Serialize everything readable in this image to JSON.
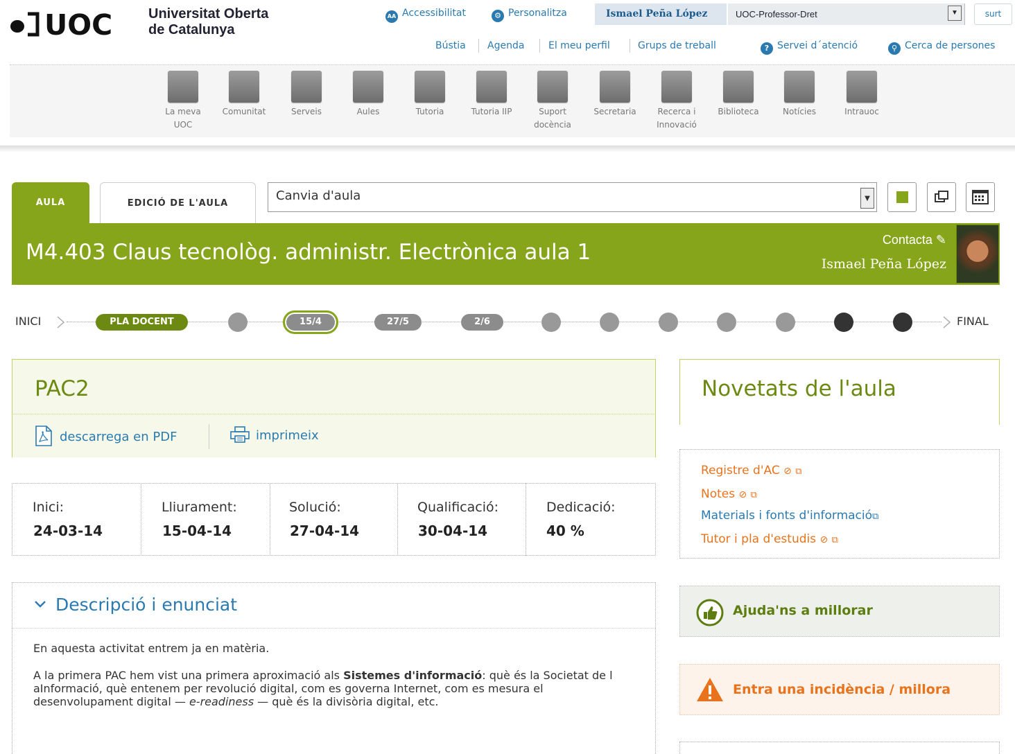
{
  "header": {
    "logo_text": "UOC",
    "university_line1": "Universitat Oberta",
    "university_line2": "de Catalunya",
    "accessibility": "Accessibilitat",
    "personalize": "Personalitza",
    "user_name": "Ismael Peña López",
    "role_value": "UOC-Professor-Dret",
    "exit_label": "surt",
    "sublinks": [
      "Bústia",
      "Agenda",
      "El meu perfil",
      "Grups de treball"
    ],
    "service_link": "Servei d´atenció",
    "people_search": "Cerca de persones"
  },
  "nav": {
    "items": [
      {
        "line1": "La meva",
        "line2": "UOC",
        "icon": "my-uoc-icon"
      },
      {
        "line1": "Comunitat",
        "line2": "",
        "icon": "community-icon"
      },
      {
        "line1": "Serveis",
        "line2": "",
        "icon": "services-icon"
      },
      {
        "line1": "Aules",
        "line2": "",
        "icon": "classrooms-icon"
      },
      {
        "line1": "Tutoria",
        "line2": "",
        "icon": "tutoring-icon"
      },
      {
        "line1": "Tutoria IIP",
        "line2": "",
        "icon": "tutoring-iip-icon"
      },
      {
        "line1": "Suport",
        "line2": "docència",
        "icon": "teaching-support-icon"
      },
      {
        "line1": "Secretaria",
        "line2": "",
        "icon": "secretariat-icon"
      },
      {
        "line1": "Recerca i",
        "line2": "Innovació",
        "icon": "research-icon"
      },
      {
        "line1": "Biblioteca",
        "line2": "",
        "icon": "library-icon"
      },
      {
        "line1": "Notícies",
        "line2": "",
        "icon": "news-icon"
      },
      {
        "line1": "Intrauoc",
        "line2": "",
        "icon": "intrauoc-icon"
      }
    ]
  },
  "aula": {
    "tab_aula": "AULA",
    "tab_edit": "EDICIÓ DE L'AULA",
    "select_value": "Canvia d'aula",
    "title": "M4.403 Claus tecnològ. administr. Electrònica aula 1",
    "contact": "Contacta",
    "tutor_name": "Ismael Peña López",
    "accent": "#86a51a"
  },
  "timeline": {
    "start": "INICI",
    "end": "FINAL",
    "plan": "PLA DOCENT",
    "current": "15/4",
    "d2": "27/5",
    "d3": "2/6"
  },
  "activity": {
    "title": "PAC2",
    "pdf": "descarrega en PDF",
    "print": "imprimeix",
    "dates": [
      {
        "label": "Inici:",
        "value": "24-03-14"
      },
      {
        "label": "Lliurament:",
        "value": "15-04-14"
      },
      {
        "label": "Solució:",
        "value": "27-04-14"
      },
      {
        "label": "Qualificació:",
        "value": "30-04-14"
      },
      {
        "label": "Dedicació:",
        "value": "40 %"
      }
    ],
    "section_title": "Descripció i enunciat",
    "p1": "En aquesta activitat entrem ja en matèria.",
    "p2_a": "A la primera PAC hem vist una primera aproximació als ",
    "p2_bold": "Sistemes d'informació",
    "p2_b": ": què és la Societat de l aInformació, què entenem per revolució digital, com es governa Internet, com es mesura el desenvolupament digital — ",
    "p2_italic": "e-readiness",
    "p2_c": " — què és la divisòria digital, etc."
  },
  "sidebar": {
    "news_title": "Novetats de l'aula",
    "links": [
      "Registre d'AC",
      "Notes",
      "Materials i fonts d'informació",
      "Tutor i pla d'estudis"
    ],
    "help": "Ajuda'ns a millorar",
    "incident": "Entra una incidència / millora"
  }
}
